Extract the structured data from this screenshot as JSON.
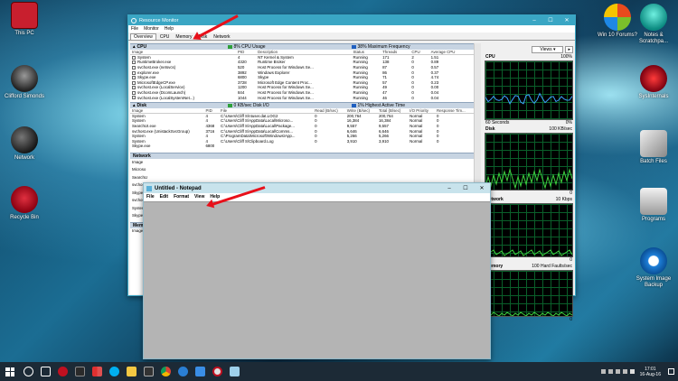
{
  "desktop_icons": [
    {
      "name": "icon-this-pc",
      "label": "This PC",
      "color": "#c81f2e"
    },
    {
      "name": "icon-clifford",
      "label": "Clifford Simonds",
      "color": "#444444"
    },
    {
      "name": "icon-network",
      "label": "Network",
      "color": "#2a2a2a"
    },
    {
      "name": "icon-recycle-bin",
      "label": "Recycle Bin",
      "color": "#c8102e"
    },
    {
      "name": "icon-win10-forums",
      "label": "Win 10 Forums?",
      "color": "#e84a1d"
    },
    {
      "name": "icon-notes",
      "label": "Notes & Scratchpa...",
      "color": "#2ad0c4"
    },
    {
      "name": "icon-sysinternals",
      "label": "SysInternals",
      "color": "#b01020"
    },
    {
      "name": "icon-batch-files",
      "label": "Batch Files",
      "color": "#dddddd"
    },
    {
      "name": "icon-programs",
      "label": "Programs",
      "color": "#cccccc"
    },
    {
      "name": "icon-system-image-backup",
      "label": "System Image Backup",
      "color": "#1e7fd8"
    }
  ],
  "resource_monitor": {
    "title": "Resource Monitor",
    "menu": [
      "File",
      "Monitor",
      "Help"
    ],
    "tabs": [
      "Overview",
      "CPU",
      "Memory",
      "Disk",
      "Network"
    ],
    "cpu": {
      "header": "CPU",
      "usage": "8% CPU Usage",
      "freq": "38% Maximum Frequency",
      "columns": [
        "Image",
        "PID",
        "Description",
        "Status",
        "Threads",
        "CPU",
        "Average CPU"
      ],
      "rows": [
        [
          "System",
          "4",
          "NT Kernel & System",
          "Running",
          "171",
          "2",
          "1.51"
        ],
        [
          "RuntimeBroker.exe",
          "4320",
          "Runtime Broker",
          "Running",
          "138",
          "0",
          "0.89"
        ],
        [
          "svchost.exe (netsvcs)",
          "520",
          "Host Process for Windows Se...",
          "Running",
          "87",
          "0",
          "0.57"
        ],
        [
          "explorer.exe",
          "3892",
          "Windows Explorer",
          "Running",
          "86",
          "0",
          "0.37"
        ],
        [
          "Skype.exe",
          "6800",
          "Skype",
          "Running",
          "71",
          "0",
          "4.74"
        ],
        [
          "MicrosoftEdgeCP.exe",
          "3728",
          "Microsoft Edge Content Proc...",
          "Running",
          "57",
          "0",
          "0.23"
        ],
        [
          "svchost.exe (LocalService)",
          "1200",
          "Host Process for Windows Se...",
          "Running",
          "49",
          "0",
          "0.00"
        ],
        [
          "svchost.exe (DcomLaunch)",
          "844",
          "Host Process for Windows Se...",
          "Running",
          "47",
          "0",
          "0.04"
        ],
        [
          "svchost.exe (LocalSystemNet...)",
          "1044",
          "Host Process for Windows Se...",
          "Running",
          "46",
          "0",
          "0.04"
        ]
      ]
    },
    "disk": {
      "header": "Disk",
      "io": "0 KB/sec Disk I/O",
      "active": "1% Highest Active Time",
      "columns": [
        "Image",
        "PID",
        "File",
        "Read (B/sec)",
        "Write (B/sec)",
        "Total (B/sec)",
        "I/O Priority",
        "Response Tim..."
      ],
      "rows": [
        [
          "System",
          "4",
          "C:\\Users\\Cliff S\\ntuser.dat.LOG2",
          "0",
          "200,764",
          "200,764",
          "Normal",
          "0"
        ],
        [
          "System",
          "4",
          "C:\\Users\\Cliff S\\AppData\\Local\\Microso...",
          "0",
          "16,384",
          "16,384",
          "Normal",
          "0"
        ],
        [
          "SearchUI.exe",
          "4368",
          "C:\\Users\\Cliff S\\AppData\\Local\\Package...",
          "0",
          "9,557",
          "9,557",
          "Normal",
          "0"
        ],
        [
          "svchost.exe (UnistackSvcGroup)",
          "3716",
          "C:\\Users\\Cliff S\\AppData\\Local\\Comms...",
          "0",
          "6,646",
          "6,646",
          "Normal",
          "0"
        ],
        [
          "System",
          "4",
          "C:\\ProgramData\\Microsoft\\Windows\\App...",
          "0",
          "5,266",
          "5,266",
          "Normal",
          "0"
        ],
        [
          "System",
          "4",
          "C:\\Users\\Cliff S\\Clipboard.Log",
          "0",
          "3,910",
          "3,910",
          "Normal",
          "0"
        ],
        [
          "Skype.exe",
          "6800",
          "",
          "",
          "",
          "",
          "",
          ""
        ]
      ]
    },
    "network": {
      "header": "Network",
      "rows": [
        "Image",
        "Microso",
        "SearchU",
        "svchost",
        "Skype.e",
        "svchost",
        "System",
        "Skype.e"
      ]
    },
    "memory": {
      "header": "Memory",
      "rows": [
        "Image"
      ]
    },
    "views_label": "Views",
    "graphs": [
      {
        "name": "CPU",
        "right": "100%",
        "footer_left": "60 Seconds",
        "footer_right": "0%",
        "color": "#3fa0ff"
      },
      {
        "name": "Disk",
        "right": "100 KB/sec",
        "footer_left": "",
        "footer_right": "0",
        "color": "#3fd23f"
      },
      {
        "name": "Network",
        "right": "10 Kbps",
        "footer_left": "",
        "footer_right": "0",
        "color": "#3fd23f"
      },
      {
        "name": "Memory",
        "right": "100 Hard Faults/sec",
        "footer_left": "",
        "footer_right": "0",
        "color": "#3fd23f"
      }
    ]
  },
  "notepad": {
    "title": "Untitled - Notepad",
    "menu": [
      "File",
      "Edit",
      "Format",
      "View",
      "Help"
    ]
  },
  "taskbar": {
    "time": "17:01",
    "date": "16-Aug-16"
  }
}
